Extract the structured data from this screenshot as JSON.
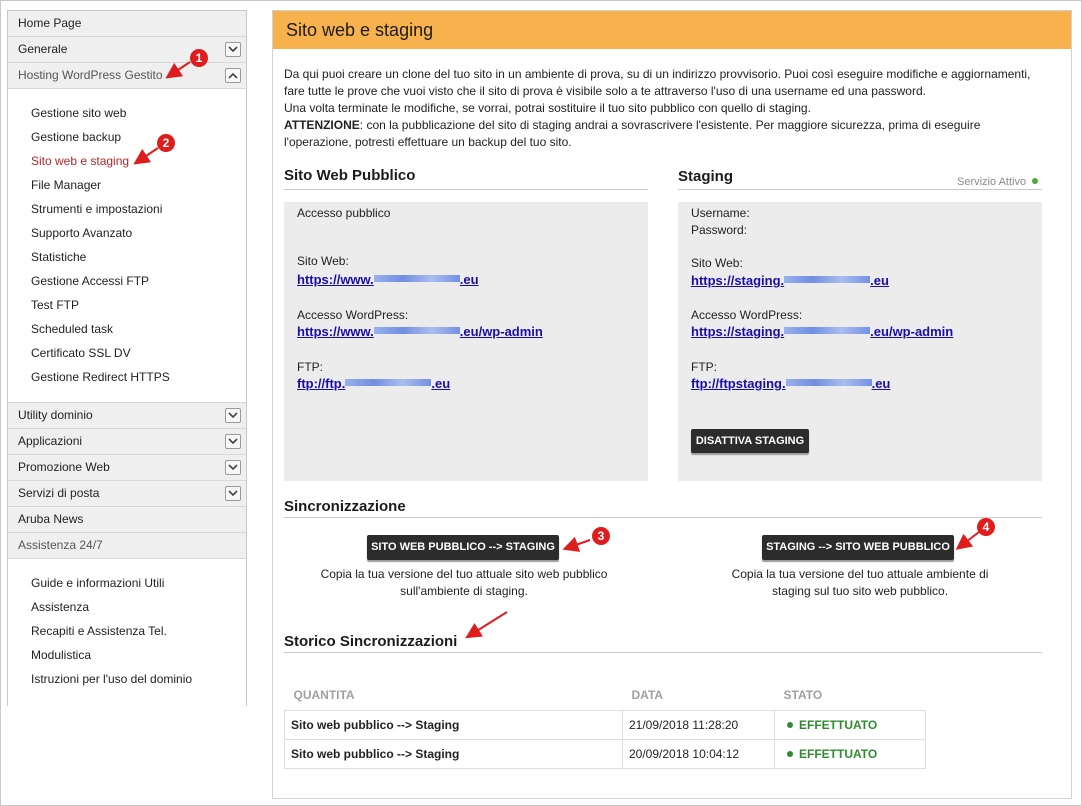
{
  "sidebar": {
    "home": "Home Page",
    "generale": "Generale",
    "hosting": "Hosting WordPress Gestito",
    "hosting_items": [
      "Gestione sito web",
      "Gestione backup",
      "Sito web e staging",
      "File Manager",
      "Strumenti e impostazioni",
      "Supporto Avanzato",
      "Statistiche",
      "Gestione Accessi FTP",
      "Test FTP",
      "Scheduled task",
      "Certificato SSL DV",
      "Gestione Redirect HTTPS"
    ],
    "utility": "Utility dominio",
    "applicazioni": "Applicazioni",
    "promozione": "Promozione Web",
    "posta": "Servizi di posta",
    "news": "Aruba News",
    "assistenza": "Assistenza 24/7",
    "assistenza_items": [
      "Guide e informazioni Utili",
      "Assistenza",
      "Recapiti e Assistenza Tel.",
      "Modulistica",
      "Istruzioni per l'uso del dominio"
    ]
  },
  "main": {
    "title": "Sito web e staging",
    "intro_lines": [
      "Da qui puoi creare un clone del tuo sito in un ambiente di prova, su di un indirizzo provvisorio. Puoi così eseguire modifiche e aggiornamenti,",
      "fare tutte le prove che vuoi visto che il sito di prova è visibile solo a te attraverso l'uso di una username ed una password.",
      "Una volta terminate le modifiche, se vorrai, potrai sostituire il tuo sito pubblico con quello di staging."
    ],
    "attention_label": "ATTENZIONE",
    "attention_line1": ": con la pubblicazione del sito di staging andrai a sovrascrivere l'esistente. Per maggiore sicurezza, prima di eseguire",
    "attention_line2": "l'operazione, potresti effettuare un backup del tuo sito.",
    "public": {
      "title": "Sito Web Pubblico",
      "access": "Accesso pubblico",
      "site_label": "Sito Web:",
      "site_pre": "https://www.",
      "site_post": ".eu",
      "wp_label": "Accesso WordPress:",
      "wp_pre": "https://www.",
      "wp_post": ".eu/wp-admin",
      "ftp_label": "FTP:",
      "ftp_pre": "ftp://ftp.",
      "ftp_post": ".eu"
    },
    "staging": {
      "title": "Staging",
      "status": "Servizio Attivo",
      "username_label": "Username:",
      "password_label": "Password:",
      "site_label": "Sito Web:",
      "site_pre": "https://staging.",
      "site_post": ".eu",
      "wp_label": "Accesso WordPress:",
      "wp_pre": "https://staging.",
      "wp_post": ".eu/wp-admin",
      "ftp_label": "FTP:",
      "ftp_pre": "ftp://ftpstaging.",
      "ftp_post": ".eu",
      "disable_button": "DISATTIVA STAGING"
    },
    "sync": {
      "title": "Sincronizzazione",
      "to_staging_button": "SITO WEB PUBBLICO --> STAGING",
      "to_staging_desc_1": "Copia la tua versione del tuo attuale sito web pubblico",
      "to_staging_desc_2": "sull'ambiente di staging.",
      "to_public_button": "STAGING --> SITO WEB PUBBLICO",
      "to_public_desc_1": "Copia la tua versione del tuo attuale ambiente di",
      "to_public_desc_2": "staging sul tuo sito web pubblico."
    },
    "history": {
      "title": "Storico Sincronizzazioni",
      "columns": [
        "QUANTITA",
        "DATA",
        "STATO"
      ],
      "rows": [
        {
          "name": "Sito web pubblico --> Staging",
          "date": "21/09/2018 11:28:20",
          "status": "EFFETTUATO"
        },
        {
          "name": "Sito web pubblico --> Staging",
          "date": "20/09/2018 10:04:12",
          "status": "EFFETTUATO"
        }
      ]
    }
  },
  "annotations": [
    "1",
    "2",
    "3",
    "4"
  ],
  "colors": {
    "header": "#f7b14d",
    "link": "#1a0dab",
    "active_menu": "#b3262b",
    "success": "#2e8b2e",
    "annotation": "#e01d1d"
  }
}
